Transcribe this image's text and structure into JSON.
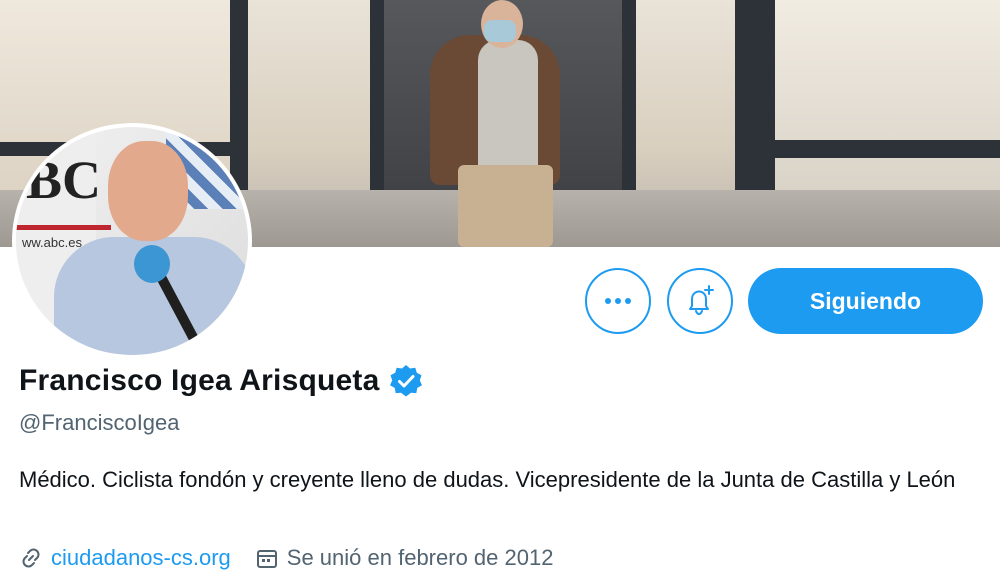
{
  "profile": {
    "name": "Francisco Igea Arisqueta",
    "handle": "@FranciscoIgea",
    "bio": "Médico. Ciclista fondón y creyente lleno de dudas. Vicepresidente de la Junta de Castilla y León",
    "website": "ciudadanos-cs.org",
    "joined": "Se unió en febrero de 2012",
    "verified": true
  },
  "actions": {
    "more_label": "···",
    "follow_label": "Siguiendo"
  },
  "avatar": {
    "logo_text": "BC",
    "site_text": "ww.abc.es"
  },
  "colors": {
    "accent": "#1d9bf0",
    "secondary_text": "#536471",
    "primary_text": "#0f1419"
  },
  "icons": {
    "more": "more-horizontal-icon",
    "bell": "bell-plus-icon",
    "verified": "verified-badge-icon",
    "link": "link-icon",
    "calendar": "calendar-icon"
  }
}
